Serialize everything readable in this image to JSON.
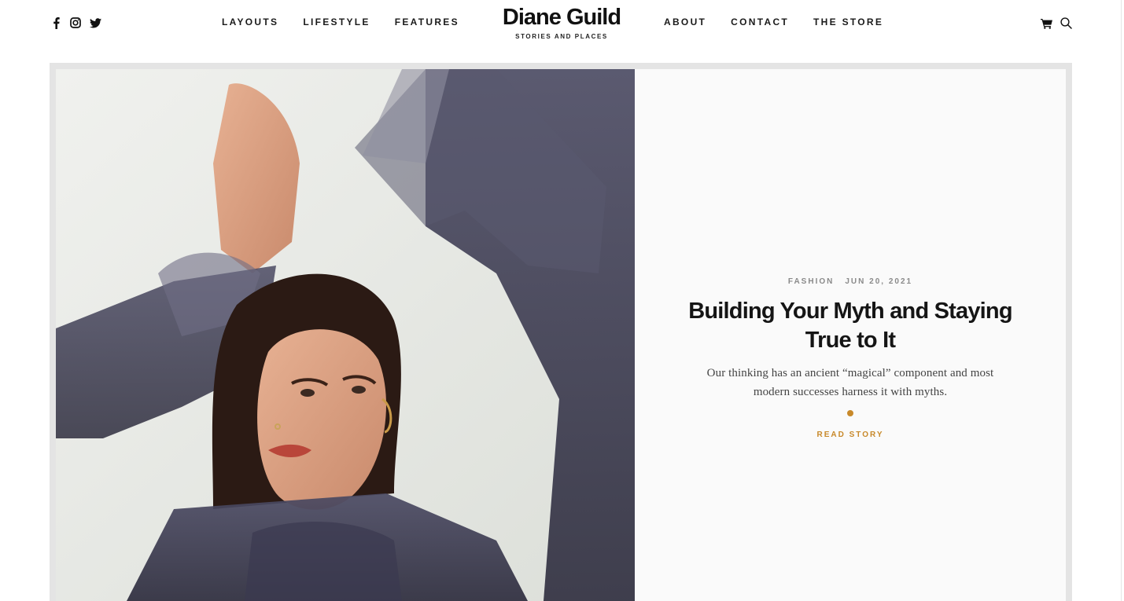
{
  "site": {
    "title": "Diane Guild",
    "tagline": "STORIES AND PLACES"
  },
  "social": [
    {
      "icon": "facebook-icon"
    },
    {
      "icon": "instagram-icon"
    },
    {
      "icon": "twitter-icon"
    }
  ],
  "nav_left": [
    {
      "label": "LAYOUTS"
    },
    {
      "label": "LIFESTYLE"
    },
    {
      "label": "FEATURES"
    }
  ],
  "nav_right": [
    {
      "label": "ABOUT"
    },
    {
      "label": "CONTACT"
    },
    {
      "label": "THE STORE"
    }
  ],
  "tools": [
    {
      "icon": "cart-icon"
    },
    {
      "icon": "search-icon"
    }
  ],
  "featured": {
    "category": "FASHION",
    "date": "JUN 20, 2021",
    "title": "Building Your Myth and Staying True to It",
    "excerpt": "Our thinking has an ancient “magical” component and most modern successes harness it with myths.",
    "cta": "READ STORY"
  },
  "colors": {
    "accent": "#c8892a",
    "text": "#151515",
    "muted": "#8a8a8a",
    "frame": "#e4e4e4",
    "panel": "#fafafa"
  }
}
